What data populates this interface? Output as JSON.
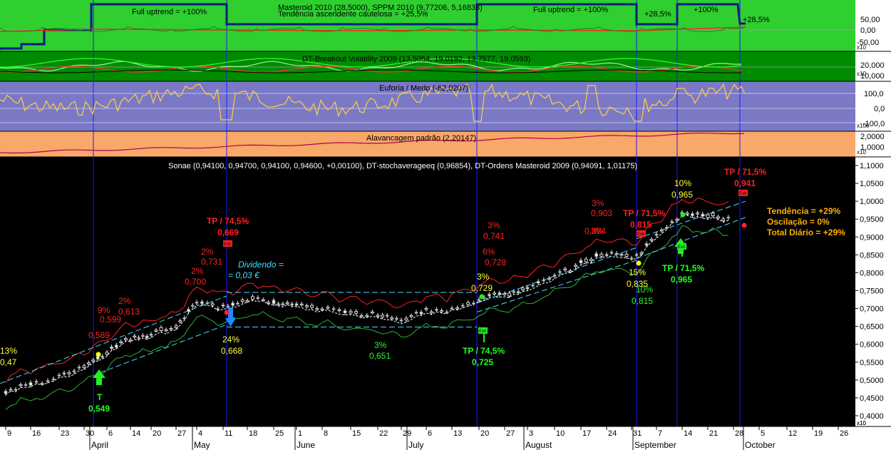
{
  "colors": {
    "panel1_bg": "#2fcf2f",
    "panel2_bg": "#008c00",
    "panel3_bg": "#7b79c6",
    "panel4_bg": "#f8a868",
    "main_bg": "#000000",
    "axis_bg": "#ffffff",
    "vline": "#1a1aff",
    "red": "#ff2020",
    "green_ind": "#22ff22",
    "yellow": "#ffff40",
    "cyan": "#40e0ff",
    "navy": "#0a1a8a"
  },
  "panels": {
    "masteroid": {
      "title": "Masteroid 2010 (28,5000), SPPM 2010 (9,77206, 5,16838)",
      "overlay_title": "Tendência ascendente cautelosa = +25,5%",
      "axis_ticks": [
        "50,00",
        "0,00",
        "-50,00"
      ],
      "scale": "x10",
      "labels": [
        "Full uptrend = +100%",
        "Full uptrend = +100%",
        "+28,5%",
        "+100%",
        "+28,5%"
      ]
    },
    "breakout": {
      "title": "DT-Breakout Volatility 2009 (13,5054, 19,0192, 13,7577, 19,0593)",
      "axis_ticks": [
        "20,000",
        "10,000"
      ],
      "scale": "x10"
    },
    "euforia": {
      "title": "Euforia / Medo (-62,0207)",
      "axis_ticks": [
        "100,0",
        "0,0",
        "-100,0"
      ],
      "scale": "x100"
    },
    "alavancagem": {
      "title": "Alavancagem padrão (2,20147)",
      "axis_ticks": [
        "2,0000",
        "1,0000"
      ],
      "scale": "x10"
    }
  },
  "main": {
    "title": "Sonae (0,94100, 0,94700, 0,94100, 0,94600, +0,00100), DT-stochaverageeq (0,96854), DT-Ordens Masteroid 2009 (0,94091, 1,01175)",
    "axis_ticks": [
      "1,1000",
      "1,0500",
      "1,0000",
      "0,9500",
      "0,9000",
      "0,8500",
      "0,8000",
      "0,7500",
      "0,7000",
      "0,6500",
      "0,6000",
      "0,5500",
      "0,5000",
      "0,4500",
      "0,4000"
    ],
    "scale": "x10",
    "dividend": [
      "Dividendo =",
      "= 0,03 €"
    ],
    "summary": [
      "Tendência = +29%",
      "Oscilação = 0%",
      "Total Diário = +29%"
    ],
    "annotations_red": [
      "TP / 74,5%",
      "0,669",
      "2%",
      "0,731",
      "2%",
      "0,700",
      "2%",
      "0,613",
      "9%",
      "0,599",
      "0,589",
      "3%",
      "0,741",
      "6%",
      "0,728",
      "3%",
      "0,903",
      "3%",
      "0,884",
      "TP / 71,5%",
      "0,815",
      "TP / 71,5%",
      "0,941"
    ],
    "annotations_yellow": [
      "13%",
      "0,47",
      "24%",
      "0,668",
      "3%",
      "0,729",
      "15%",
      "0,835",
      "10%",
      "0,965"
    ],
    "annotations_green": [
      "T",
      "0,549",
      "3%",
      "0,651",
      "TP / 74,5%",
      "0,725",
      "10%",
      "0,815",
      "TP / 71,5%",
      "0,965"
    ],
    "tags": [
      "Exit",
      "Exit",
      "Exit",
      "Exit",
      "Exit"
    ]
  },
  "x_axis": {
    "day_ticks": [
      "9",
      "16",
      "23",
      "30",
      "6",
      "14",
      "20",
      "27",
      "4",
      "11",
      "18",
      "25",
      "1",
      "8",
      "15",
      "22",
      "29",
      "6",
      "13",
      "20",
      "27",
      "3",
      "10",
      "17",
      "24",
      "31",
      "7",
      "14",
      "21",
      "28",
      "5",
      "12",
      "19",
      "26"
    ],
    "months": [
      "April",
      "May",
      "June",
      "July",
      "August",
      "September",
      "October"
    ],
    "scale": "x10"
  },
  "chart_data": {
    "type": "candlestick",
    "title": "Sonae (0,94100, 0,94700, 0,94100, 0,94600, +0,00100), DT-stochaverageeq (0,96854), DT-Ordens Masteroid 2009 (0,94091, 1,01175)",
    "ylim": [
      0.37,
      1.12
    ],
    "x": [
      "9",
      "16",
      "23",
      "30",
      "6",
      "14",
      "20",
      "27",
      "4",
      "11",
      "18",
      "25",
      "1",
      "8",
      "15",
      "22",
      "29",
      "6",
      "13",
      "20",
      "27",
      "3",
      "10",
      "17",
      "24",
      "31",
      "7",
      "14",
      "21",
      "28",
      "5",
      "12",
      "19",
      "26"
    ],
    "series": [
      {
        "values": [
          0.47,
          0.49,
          0.51,
          0.54,
          0.58,
          0.62,
          0.63,
          0.65,
          0.72,
          0.7,
          0.73,
          0.72,
          0.71,
          0.7,
          0.69,
          0.68,
          0.67,
          0.69,
          0.7,
          0.73,
          0.74,
          0.76,
          0.79,
          0.83,
          0.86,
          0.84,
          0.9,
          0.97,
          0.96,
          0.95,
          null,
          null,
          null,
          null
        ]
      }
    ]
  }
}
